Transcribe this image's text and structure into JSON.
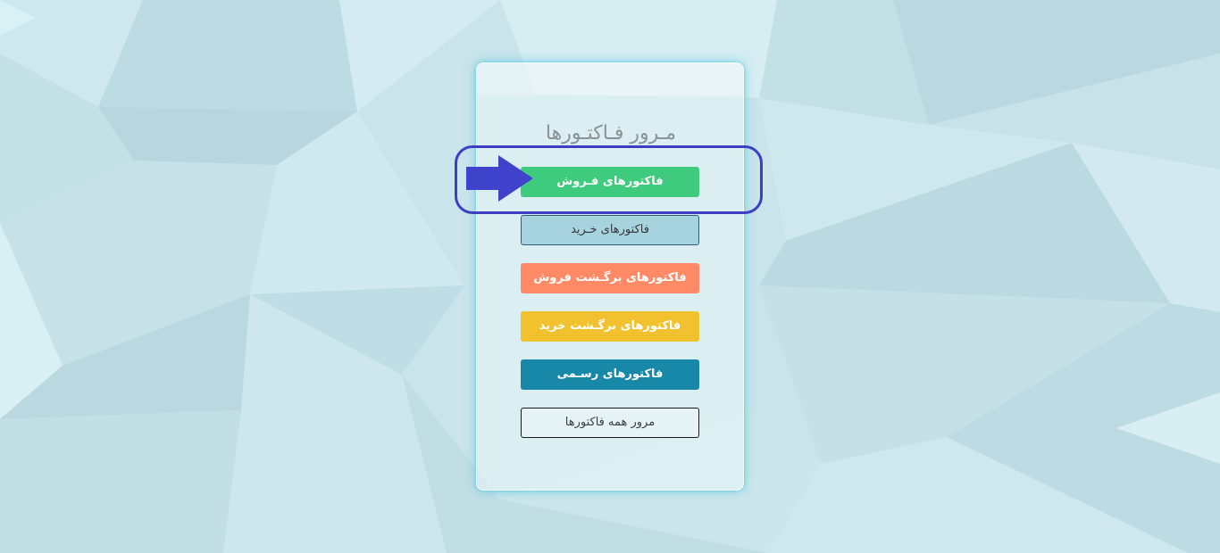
{
  "panel": {
    "title": "مـرور فـاکتـورها"
  },
  "buttons": [
    {
      "id": "sales",
      "label": "فاکتورهای فـروش"
    },
    {
      "id": "purchase",
      "label": "فاکتورهای خـرید"
    },
    {
      "id": "return_sales",
      "label": "فاکتورهای برگـشت فروش"
    },
    {
      "id": "return_purchase",
      "label": "فاکتورهای برگـشت خرید"
    },
    {
      "id": "official",
      "label": "فاکتورهای رسـمی"
    },
    {
      "id": "all",
      "label": "مرور همه فاکتورها"
    }
  ],
  "annotation": {
    "highlight_color": "#3d3fc2",
    "arrow_icon": "arrow-right-icon"
  },
  "colors": {
    "sales": "#3ecb7e",
    "purchase": "#a7d3df",
    "return_sales": "#ff8a65",
    "return_purchase": "#f2c12e",
    "official": "#1788a8"
  }
}
